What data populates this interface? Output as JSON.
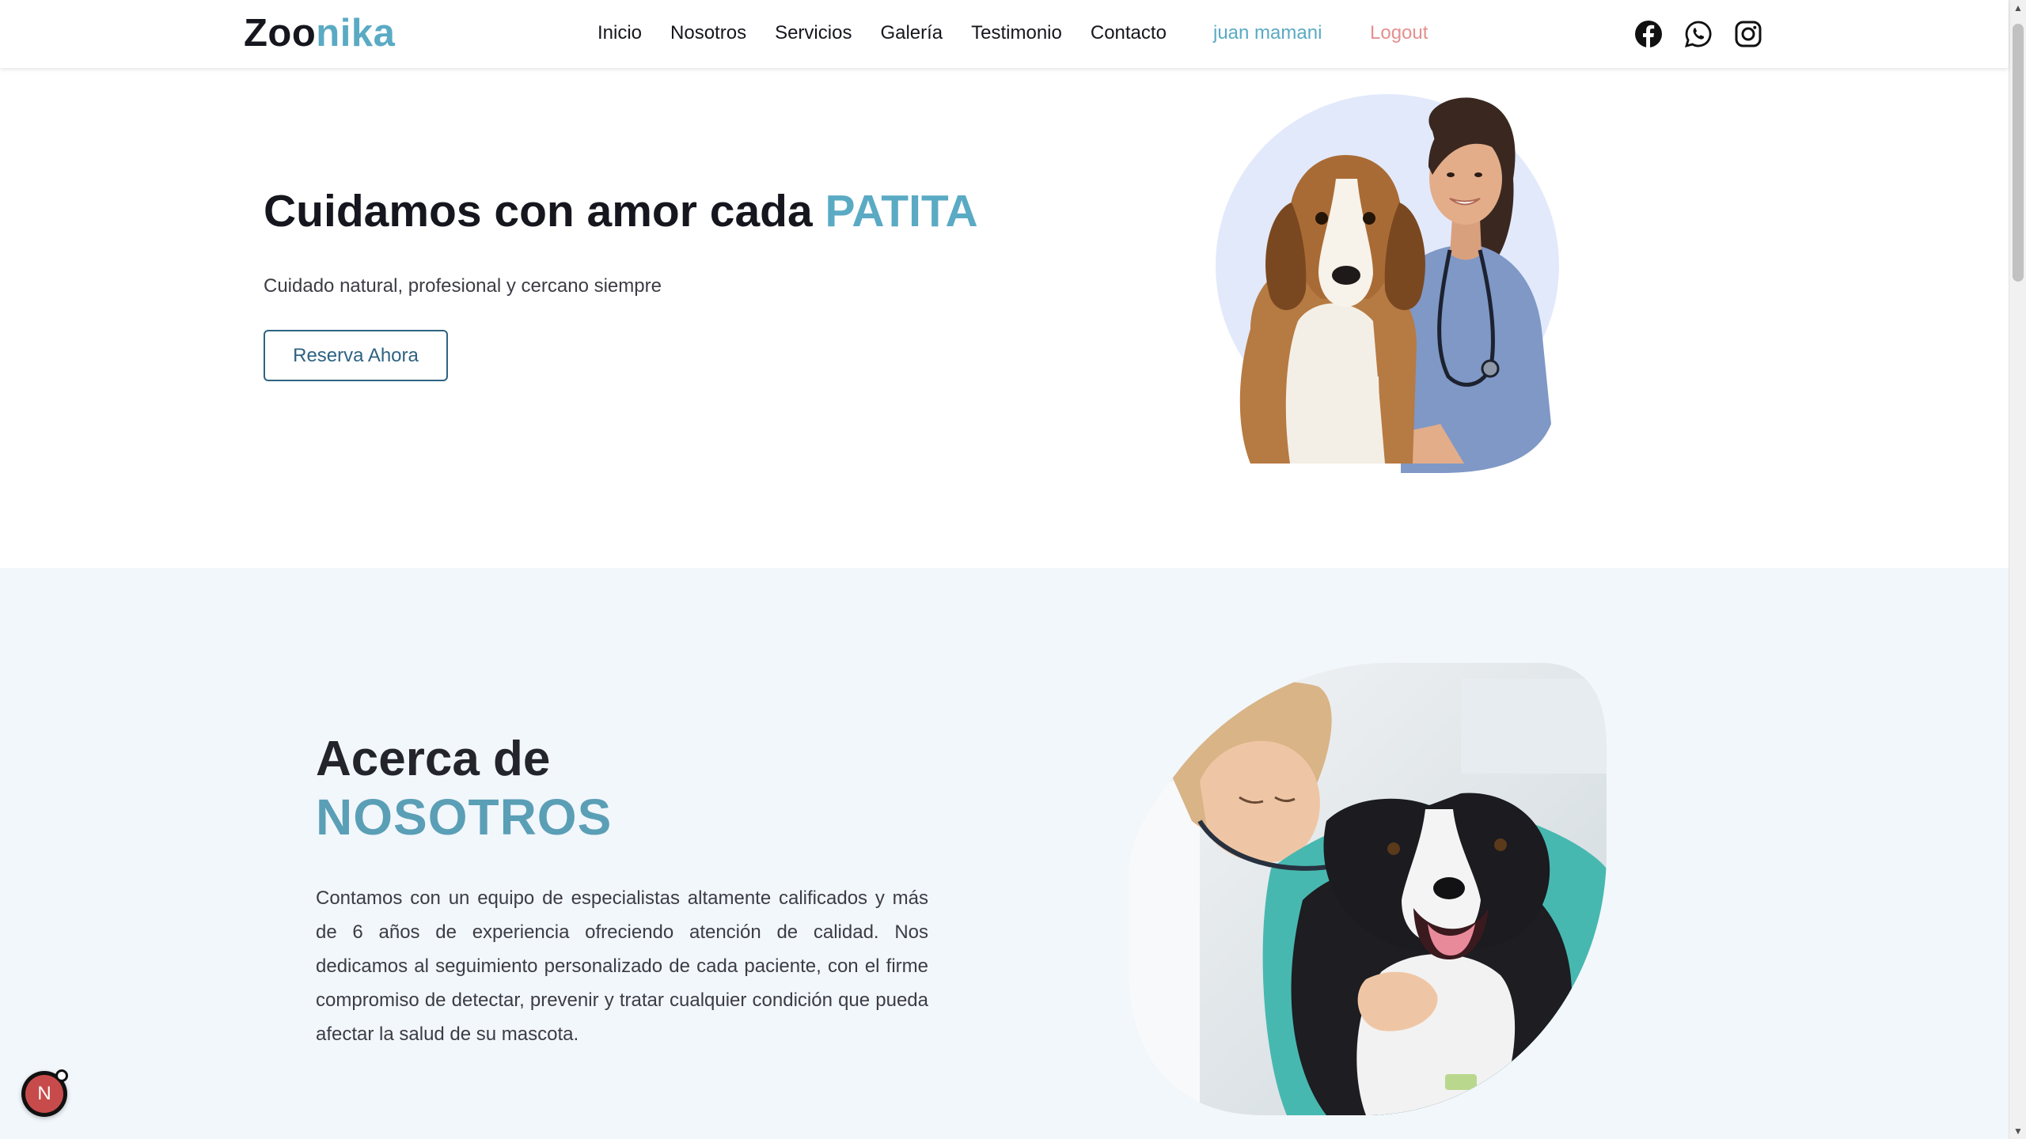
{
  "navbar": {
    "brand_part1": "Zoo",
    "brand_part2": "nika",
    "links": [
      "Inicio",
      "Nosotros",
      "Servicios",
      "Galería",
      "Testimonio",
      "Contacto"
    ],
    "user_name": "juan mamani",
    "logout_label": "Logout",
    "social_icons": [
      "facebook-icon",
      "whatsapp-icon",
      "instagram-icon"
    ]
  },
  "hero": {
    "title_prefix": "Cuidamos con amor cada ",
    "title_accent": "PATITA",
    "subtitle": "Cuidado natural, profesional y cercano siempre",
    "cta_label": "Reserva Ahora"
  },
  "about": {
    "heading_line1": "Acerca de",
    "heading_line2": "NOSOTROS",
    "body": "Contamos con un equipo de especialistas altamente calificados y más de 6 años de experiencia ofreciendo atención de calidad. Nos dedicamos al seguimiento personalizado de cada paciente, con el firme compromiso de detectar, prevenir y tratar cualquier condición que pueda afectar la salud de su mascota."
  },
  "badge": {
    "letter": "N"
  },
  "colors": {
    "accent": "#5aaac4",
    "logout": "#e68f8f",
    "button_border": "#2e6382",
    "about_bg": "#f2f7fc"
  }
}
